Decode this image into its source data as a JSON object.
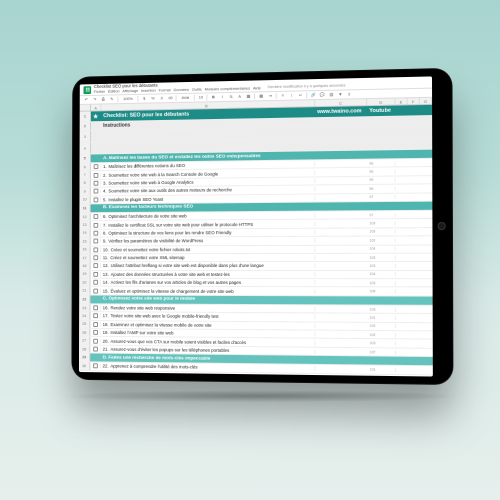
{
  "app": {
    "doc_title": "Checklist SEO pour les débutants",
    "menus": [
      "Fichier",
      "Édition",
      "Affichage",
      "Insertion",
      "Format",
      "Données",
      "Outils",
      "Modules complémentaires",
      "Aide"
    ],
    "last_edit": "Dernière modification il y a quelques secondes"
  },
  "columns": [
    "A",
    "B",
    "C",
    "D",
    "E",
    "F",
    "G",
    "H"
  ],
  "header": {
    "icon": "star",
    "title": "Checklist: SEO pour les débutants",
    "site": "www.twaino.com",
    "social": "Youtube"
  },
  "instructions_label": "Instructions",
  "sections": [
    {
      "style": "section",
      "title": "A. Maîtrisez les bases du SEO et installez les outils SEO indispensables",
      "items": [
        {
          "n": 1,
          "text": "Maîtrisez les différentes notions du SEO"
        },
        {
          "n": 2,
          "text": "Soumettez votre site web à la Search Console de Google"
        },
        {
          "n": 3,
          "text": "Soumettez votre site web à Google Analytics"
        },
        {
          "n": 4,
          "text": "Soumettez votre site aux outils des autres moteurs de recherche"
        },
        {
          "n": 5,
          "text": "Installez le plugin SEO Yoast"
        }
      ]
    },
    {
      "style": "section",
      "title": "B. Examinez les facteurs techniques SEO",
      "items": [
        {
          "n": 6,
          "text": "Optimisez l'architecture de votre site web"
        },
        {
          "n": 7,
          "text": "Installez le certificat SSL sur votre site web pour utiliser le protocole HTTPS"
        },
        {
          "n": 8,
          "text": "Optimisez la structure de vos liens pour les rendre SEO Friendly"
        },
        {
          "n": 9,
          "text": "Vérifiez les paramètres de visibilité de WordPress"
        },
        {
          "n": 10,
          "text": "Créez et soumettez votre fichier robots.txt"
        },
        {
          "n": 11,
          "text": "Créez et soumettez votre XML sitemap"
        },
        {
          "n": 12,
          "text": "Utilisez l'attribut hreflang si votre site web est disponible dans plus d'une langue"
        },
        {
          "n": 13,
          "text": "Ajoutez des données structurées à votre site web et testez-les"
        },
        {
          "n": 14,
          "text": "Activez les fils d'arianes sur vos articles de blog et vos autres pages"
        },
        {
          "n": 15,
          "text": "Évaluez et optimisez la vitesse de chargement de votre site web"
        }
      ]
    },
    {
      "style": "section-alt",
      "title": "C. Optimisez votre site web pour le mobile",
      "items": [
        {
          "n": 16,
          "text": "Rendez votre site web responsive"
        },
        {
          "n": 17,
          "text": "Testez votre site web avec le Google mobile-friendly test"
        },
        {
          "n": 18,
          "text": "Examinez et optimisez la vitesse mobile de votre site"
        },
        {
          "n": 19,
          "text": "Installez l'AMP sur votre site web"
        },
        {
          "n": 20,
          "text": "Assurez-vous que vos CTA sur mobile soient visibles et faciles d'accès"
        },
        {
          "n": 21,
          "text": "Assurez-vous d'éviter les popups sur les téléphones portables"
        }
      ]
    },
    {
      "style": "section-alt",
      "title": "D. Faites une recherche de mots-clés impeccable",
      "items": [
        {
          "n": 22,
          "text": "Apprenez à comprendre l'utilité des mots-clés"
        }
      ]
    }
  ],
  "row_numbers": [
    1,
    2,
    3,
    4,
    "",
    "",
    "",
    "",
    "",
    "",
    "",
    "",
    "",
    "",
    "",
    "",
    "",
    "",
    "",
    "",
    "",
    "",
    "",
    "",
    "",
    "",
    "",
    "",
    "",
    "",
    ""
  ],
  "status_rows": [
    "96",
    "96",
    "96",
    "96",
    "97",
    "97",
    "103",
    "103",
    "102",
    "104",
    "103",
    "103",
    "104",
    "103",
    "106",
    "103",
    "101",
    "102",
    "102",
    "103",
    "107",
    "101"
  ],
  "toolbar_icons": [
    "undo",
    "redo",
    "print",
    "paint",
    "zoom",
    "currency",
    "percent",
    "decimals-dec",
    "decimals-inc",
    "font",
    "size",
    "bold",
    "italic",
    "strike",
    "fill",
    "borders",
    "align",
    "wrap",
    "merge",
    "filter",
    "functions"
  ]
}
